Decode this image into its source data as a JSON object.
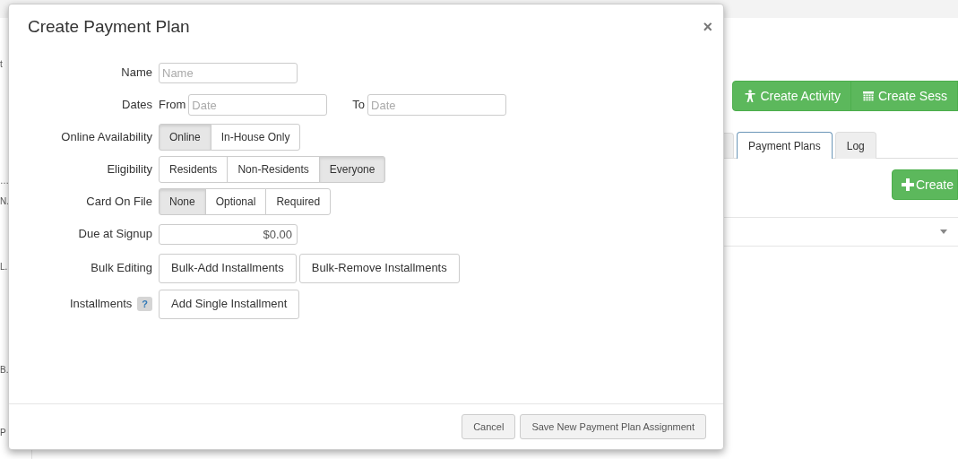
{
  "background": {
    "side_fragments": [
      "t",
      "…",
      "N.",
      "L.",
      "B.",
      "P"
    ],
    "actions": [
      {
        "label": "Create Activity",
        "kind": "person"
      },
      {
        "label": "Create Sess",
        "kind": "calendar"
      }
    ],
    "tabs": [
      {
        "label": "Payment Plans",
        "selected": true
      },
      {
        "label": "Log",
        "selected": false
      }
    ],
    "create_button": "Create"
  },
  "modal": {
    "title": "Create Payment Plan",
    "close": "×",
    "fields": [
      {
        "kind": "text",
        "label": "Name",
        "placeholder": "Name"
      },
      {
        "kind": "daterange",
        "label": "Dates",
        "from_label": "From",
        "from_placeholder": "Date",
        "to_label": "To",
        "to_placeholder": "Date"
      },
      {
        "kind": "toggle",
        "label": "Online Availability",
        "options": [
          {
            "label": "Online",
            "selected": true
          },
          {
            "label": "In-House Only",
            "selected": false
          }
        ]
      },
      {
        "kind": "toggle",
        "label": "Eligibility",
        "options": [
          {
            "label": "Residents",
            "selected": false
          },
          {
            "label": "Non-Residents",
            "selected": false
          },
          {
            "label": "Everyone",
            "selected": true
          }
        ]
      },
      {
        "kind": "toggle",
        "label": "Card On File",
        "options": [
          {
            "label": "None",
            "selected": true
          },
          {
            "label": "Optional",
            "selected": false
          },
          {
            "label": "Required",
            "selected": false
          }
        ]
      },
      {
        "kind": "money",
        "label": "Due at Signup",
        "value": "$0.00"
      },
      {
        "kind": "buttons",
        "label": "Bulk Editing",
        "buttons": [
          "Bulk-Add Installments",
          "Bulk-Remove Installments"
        ]
      },
      {
        "kind": "buttons",
        "label": "Installments",
        "help": "?",
        "buttons": [
          "Add Single Installment"
        ]
      }
    ],
    "footer_buttons": [
      "Cancel",
      "Save New Payment Plan Assignment"
    ]
  }
}
